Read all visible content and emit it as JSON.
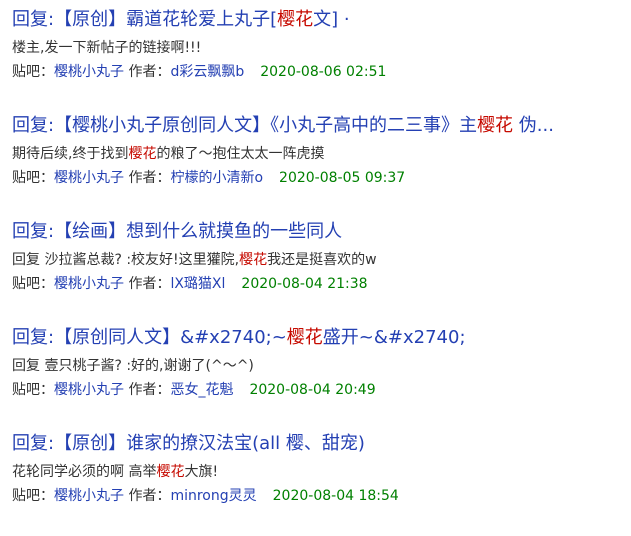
{
  "results": [
    {
      "title_pre": "回复:【原创】霸道花轮爱上丸子[",
      "title_hl": "樱花",
      "title_post": "文] ·",
      "snippet_pre": "楼主,发一下新帖子的链接啊!!!",
      "snippet_hl": "",
      "snippet_post": "",
      "forum_label": "贴吧：",
      "forum": "樱桃小丸子",
      "author_label": "作者：",
      "author": "d彩云飘飘b",
      "date": "2020-08-06 02:51"
    },
    {
      "title_pre": "回复:【樱桃小丸子原创同人文】《小丸子高中的二三事》主",
      "title_hl": "樱花",
      "title_post": " 伪...",
      "snippet_pre": "期待后续,终于找到",
      "snippet_hl": "樱花",
      "snippet_post": "的粮了～抱住太太一阵虎摸",
      "forum_label": "贴吧：",
      "forum": "樱桃小丸子",
      "author_label": "作者：",
      "author": "柠檬的小清新o",
      "date": "2020-08-05 09:37"
    },
    {
      "title_pre": "回复:【绘画】想到什么就摸鱼的一些同人",
      "title_hl": "",
      "title_post": "",
      "snippet_pre": "回复 沙拉酱总裁? :校友好!这里獾院,",
      "snippet_hl": "樱花",
      "snippet_post": "我还是挺喜欢的w",
      "forum_label": "贴吧：",
      "forum": "樱桃小丸子",
      "author_label": "作者：",
      "author": "lX璐猫Xl",
      "date": "2020-08-04 21:38"
    },
    {
      "title_pre": "回复:【原创同人文】&#x2740;~",
      "title_hl": "樱花",
      "title_post": "盛开~&#x2740;",
      "snippet_pre": "回复 壹只桃子酱? :好的,谢谢了(^～^)",
      "snippet_hl": "",
      "snippet_post": "",
      "forum_label": "贴吧：",
      "forum": "樱桃小丸子",
      "author_label": "作者：",
      "author": "恶女_花魁",
      "date": "2020-08-04 20:49"
    },
    {
      "title_pre": "回复:【原创】谁家的撩汉法宝(all 樱、甜宠)",
      "title_hl": "",
      "title_post": "",
      "snippet_pre": "花轮同学必须的啊 高举",
      "snippet_hl": "樱花",
      "snippet_post": "大旗!",
      "forum_label": "贴吧：",
      "forum": "樱桃小丸子",
      "author_label": "作者：",
      "author": "minrong灵灵",
      "date": "2020-08-04 18:54"
    }
  ],
  "colors": {
    "title": "#2440b3",
    "highlight": "#c60a00",
    "text": "#333333",
    "date": "#008000"
  }
}
